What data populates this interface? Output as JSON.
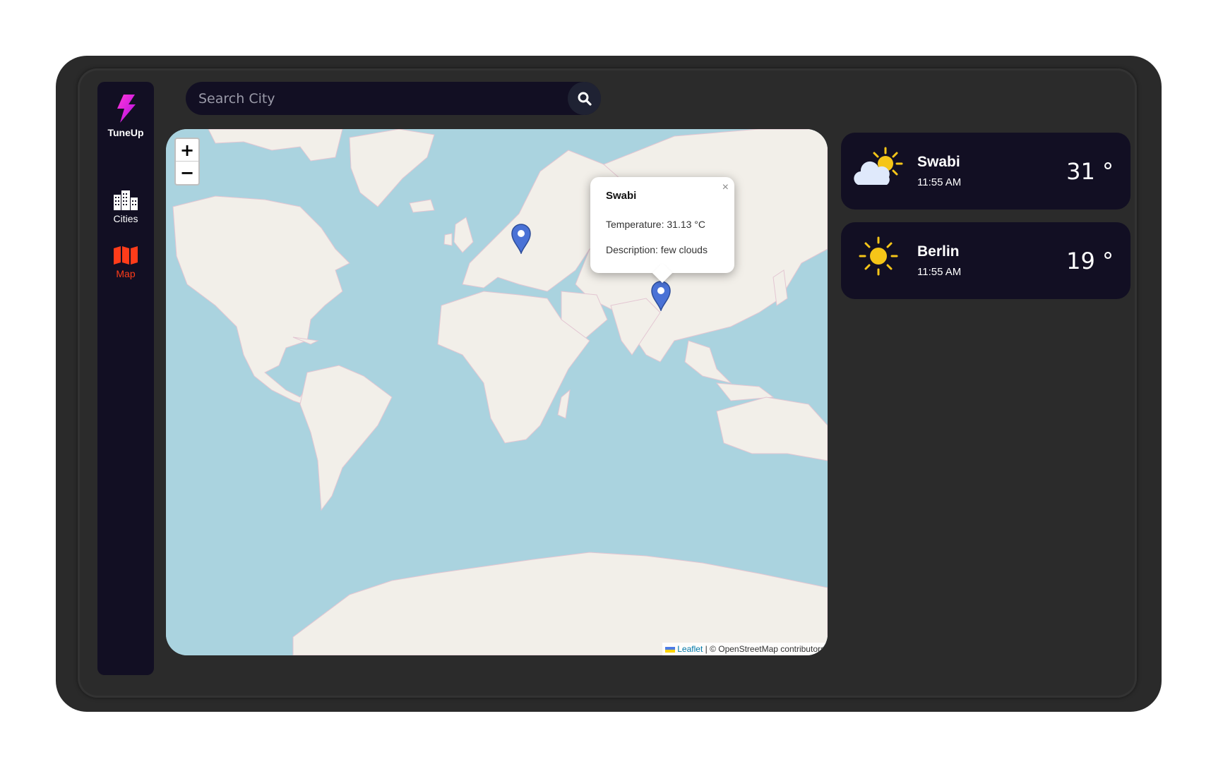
{
  "app": {
    "name": "TuneUp"
  },
  "nav": [
    {
      "label": "Cities",
      "icon": "city-icon",
      "active": false
    },
    {
      "label": "Map",
      "icon": "map-icon",
      "active": true
    }
  ],
  "search": {
    "placeholder": "Search City",
    "value": ""
  },
  "map": {
    "zoom_in": "+",
    "zoom_out": "−",
    "popup": {
      "title": "Swabi",
      "temperature": "Temperature: 31.13 °C",
      "description": "Description: few clouds",
      "close": "×"
    },
    "attribution": {
      "leaflet": "Leaflet",
      "rest": " | © OpenStreetMap contributors"
    },
    "markers": [
      "Berlin",
      "Swabi"
    ]
  },
  "cards": [
    {
      "city": "Swabi",
      "time": "11:55 AM",
      "temp": "31 °",
      "icon": "partly-cloudy-icon"
    },
    {
      "city": "Berlin",
      "time": "11:55 AM",
      "temp": "19 °",
      "icon": "sun-icon"
    }
  ],
  "colors": {
    "panel": "#120f23",
    "accent_map": "#ff3c1a",
    "logo": "#e81aff",
    "water": "#aad3df",
    "land": "#f2efe9",
    "marker": "#4a72d6"
  }
}
